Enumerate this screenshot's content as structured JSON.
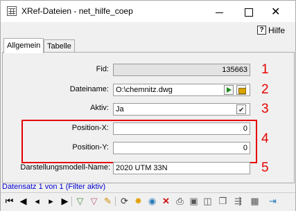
{
  "window": {
    "title": "XRef-Dateien - net_hilfe_coep",
    "help_label": "Hilfe"
  },
  "tabs": [
    {
      "label": "Allgemein"
    },
    {
      "label": "Tabelle"
    }
  ],
  "fields": {
    "fid": {
      "label": "Fid:",
      "value": "135663"
    },
    "dateiname": {
      "label": "Dateiname:",
      "value": "O:\\chemnitz.dwg"
    },
    "aktiv": {
      "label": "Aktiv:",
      "value": "Ja"
    },
    "position_x": {
      "label": "Position-X:",
      "value": "0"
    },
    "position_y": {
      "label": "Position-Y:",
      "value": "0"
    },
    "darstellungsmodell": {
      "label": "Darstellungsmodell-Name:",
      "value": "2020 UTM 33N"
    }
  },
  "annotations": [
    "1",
    "2",
    "3",
    "4",
    "5"
  ],
  "status": "Datensatz 1 von 1 (Filter aktiv)",
  "colors": {
    "annotation": "#e60000",
    "status_text": "#0000cc",
    "play_green": "#1a8a1a"
  }
}
